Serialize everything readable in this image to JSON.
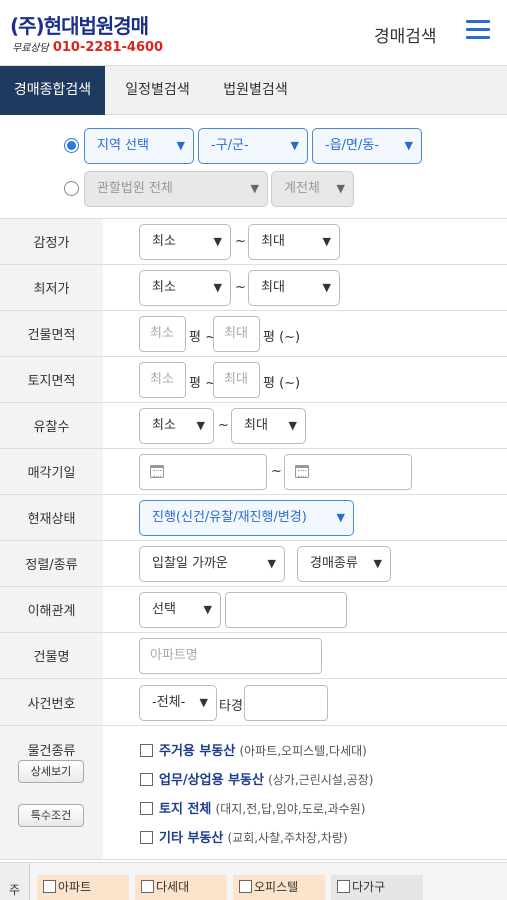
{
  "header": {
    "logo_main": "(주)현대법원경매",
    "logo_free": "무료상담",
    "logo_phone": "010-2281-4600",
    "page_title": "경매검색"
  },
  "tabs": [
    {
      "label": "경매종합검색",
      "active": true
    },
    {
      "label": "일정별검색",
      "active": false
    },
    {
      "label": "법원별검색",
      "active": false
    }
  ],
  "region": {
    "area_select": "지역 선택",
    "district_select": "-구/군-",
    "town_select": "-읍/면/동-",
    "court_select": "관할법원 전체",
    "court_branch_select": "계전체"
  },
  "rows": {
    "appraisal": {
      "label": "감정가",
      "min": "최소",
      "max": "최대"
    },
    "minimum_price": {
      "label": "최저가",
      "min": "최소",
      "max": "최대"
    },
    "building_area": {
      "label": "건물면적",
      "min_placeholder": "최소",
      "max_placeholder": "최대",
      "unit": "평",
      "tilde": "~",
      "suffix": "평 (~)"
    },
    "land_area": {
      "label": "토지면적",
      "min_placeholder": "최소",
      "max_placeholder": "최대",
      "unit": "평",
      "tilde": "~",
      "suffix": "평 (~)"
    },
    "failed_bids": {
      "label": "유찰수",
      "min": "최소",
      "max": "최대"
    },
    "sale_date": {
      "label": "매각기일",
      "tilde": "~"
    },
    "status": {
      "label": "현재상태",
      "value": "진행(신건/유찰/재진행/변경)"
    },
    "sort": {
      "label": "정렬/종류",
      "sort_value": "입찰일 가까운",
      "type_value": "경매종류"
    },
    "interest": {
      "label": "이해관계",
      "select_value": "선택"
    },
    "building_name": {
      "label": "건물명",
      "placeholder": "아파트명"
    },
    "case_number": {
      "label": "사건번호",
      "select_value": "-전체-",
      "suffix": "타경"
    }
  },
  "property_types": {
    "label": "물건종류",
    "detail_button": "상세보기",
    "special_button": "특수조건",
    "items": [
      {
        "name": "주거용 부동산",
        "desc": "(아파트,오피스텔,다세대)"
      },
      {
        "name": "업무/상업용 부동산",
        "desc": "(상가,근린시설,공장)"
      },
      {
        "name": "토지 전체",
        "desc": "(대지,전,답,임야,도로,과수원)"
      },
      {
        "name": "기타 부동산",
        "desc": "(교회,사찰,주차장,차량)"
      }
    ]
  },
  "bottom_strip": {
    "label": "주",
    "chips": [
      "아파트",
      "다세대",
      "오피스텔",
      "다가구"
    ]
  },
  "arrow": "▼",
  "tilde": "~"
}
